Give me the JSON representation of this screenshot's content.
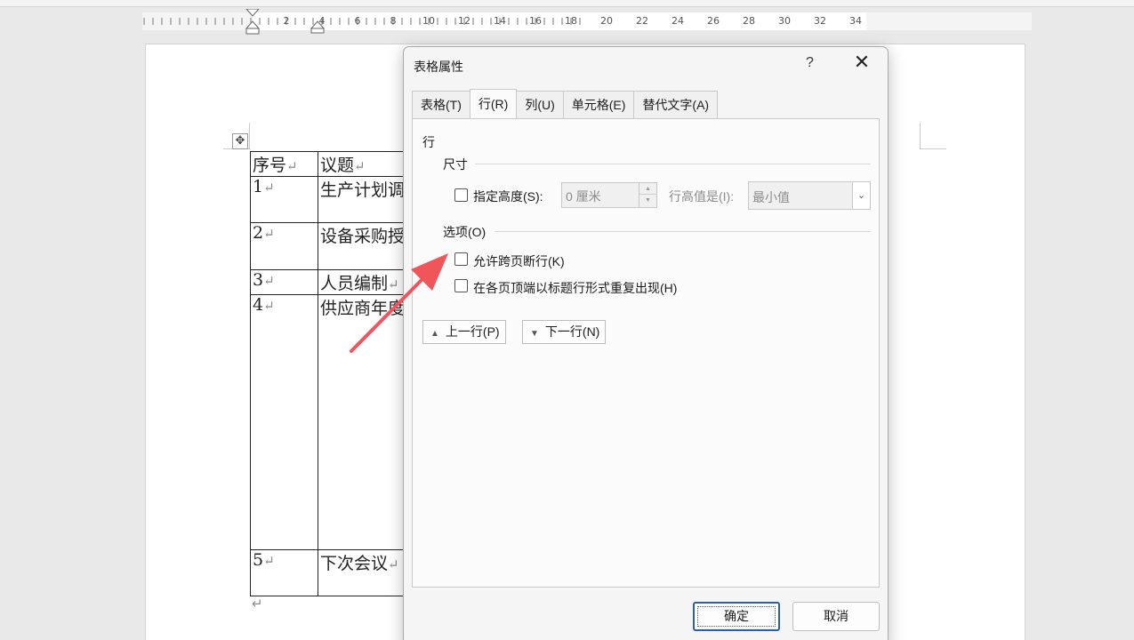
{
  "ruler": {
    "numbers": [
      "2",
      "4",
      "6",
      "8",
      "10",
      "12",
      "14",
      "16",
      "18",
      "20",
      "22",
      "24",
      "26",
      "28",
      "30",
      "32",
      "34"
    ]
  },
  "document": {
    "return_mark": "↵",
    "header": [
      "序号",
      "议题"
    ],
    "rows": [
      {
        "num": "1",
        "topic": "生产计划调"
      },
      {
        "num": "2",
        "topic": "设备采购授"
      },
      {
        "num": "3",
        "topic": "人员编制"
      },
      {
        "num": "4",
        "topic": "供应商年度"
      },
      {
        "num": "5",
        "topic": "下次会议"
      }
    ]
  },
  "dialog": {
    "title": "表格属性",
    "help": "?",
    "close": "✕",
    "tabs": [
      "表格(T)",
      "行(R)",
      "列(U)",
      "单元格(E)",
      "替代文字(A)"
    ],
    "active_tab": "行(R)",
    "section_row": "行",
    "section_size": "尺寸",
    "specify_height_label": "指定高度(S):",
    "height_value": "0 厘米",
    "row_height_is_label": "行高值是(I):",
    "row_height_mode": "最小值",
    "section_options": "选项(O)",
    "allow_break_label": "允许跨页断行(K)",
    "repeat_header_label": "在各页顶端以标题行形式重复出现(H)",
    "prev_row": "上一行(P)",
    "next_row": "下一行(N)",
    "ok": "确定",
    "cancel": "取消"
  },
  "colors": {
    "arrow": "#f0555a",
    "ok_border": "#2b5fa6"
  }
}
